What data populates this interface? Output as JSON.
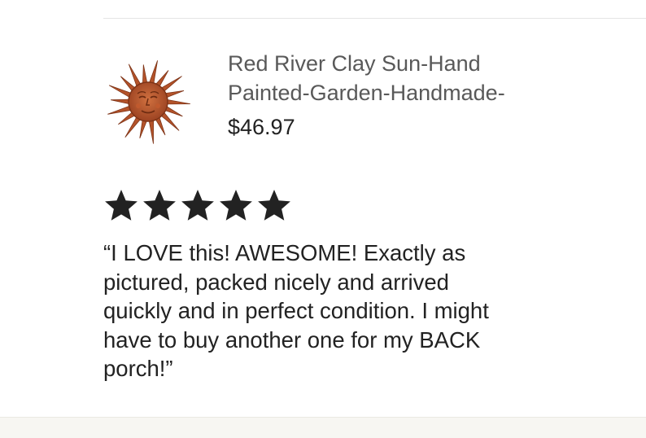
{
  "product": {
    "title_line1": "Red River Clay Sun-Hand",
    "title_line2": "Painted-Garden-Handmade-",
    "price": "$46.97",
    "image_icon": "sun-face-icon"
  },
  "review": {
    "rating": 5,
    "rating_max": 5,
    "text_lines": [
      "“I LOVE this! AWESOME! Exactly as",
      "pictured, packed nicely and arrived",
      "quickly and in perfect condition. I might",
      "have to buy another one for my BACK",
      "porch!”"
    ]
  },
  "colors": {
    "title": "#595959",
    "text": "#222222",
    "star": "#222222",
    "sun": "#b4532a"
  }
}
